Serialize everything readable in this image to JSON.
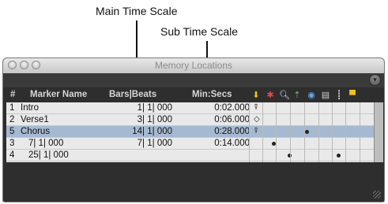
{
  "callouts": {
    "main_time_scale": "Main Time Scale",
    "sub_time_scale": "Sub Time Scale"
  },
  "window": {
    "title": "Memory Locations"
  },
  "columns": {
    "number": "#",
    "marker_name": "Marker Name",
    "bars_beats": "Bars|Beats",
    "min_secs": "Min:Secs"
  },
  "column_icons": [
    "marker-icon",
    "tempo-icon",
    "zoom-icon",
    "pre-post-roll-icon",
    "track-show-hide-icon",
    "track-height-icon",
    "group-enable-icon",
    "window-config-icon"
  ],
  "rows": [
    {
      "num": "1",
      "name": "Intro",
      "bars_beats": "1| 1| 000",
      "min_secs": "0:02.000",
      "glyph": "⍒",
      "dots": []
    },
    {
      "num": "2",
      "name": "Verse1",
      "bars_beats": "3| 1| 000",
      "min_secs": "0:06.000",
      "glyph": "◇",
      "dots": []
    },
    {
      "num": "5",
      "name": "Chorus",
      "bars_beats": "14| 1| 000",
      "min_secs": "0:28.000",
      "glyph": "⍒",
      "dots": [
        3
      ],
      "selected": true
    },
    {
      "num": "3",
      "name": "7| 1| 000",
      "bars_beats": "7| 1| 000",
      "min_secs": "0:14.000",
      "glyph": "",
      "dots": [
        1
      ]
    },
    {
      "num": "4",
      "name": "25| 1| 000",
      "bars_beats": "",
      "min_secs": "",
      "glyph": "",
      "dots": [
        2,
        5
      ]
    }
  ],
  "colors": {
    "window_bg": "#2e2e2e",
    "list_bg": "#e9e9e9",
    "selection": "#a5b9d2",
    "marker_icon": "#f0c419"
  }
}
